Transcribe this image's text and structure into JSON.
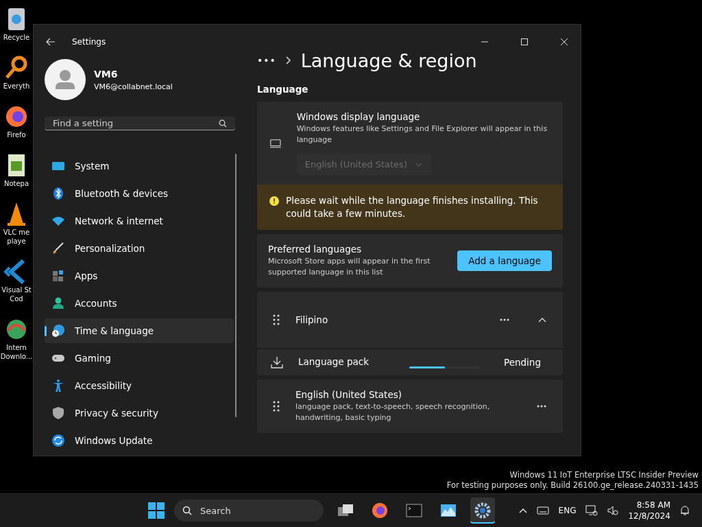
{
  "desktop_icons": [
    {
      "kind": "recycle",
      "label": "Recycle"
    },
    {
      "kind": "search",
      "label": "Everyth"
    },
    {
      "kind": "firefox",
      "label": "Firefo"
    },
    {
      "kind": "notepad",
      "label": "Notepa"
    },
    {
      "kind": "cone",
      "label": "VLC me\nplaye"
    },
    {
      "kind": "code",
      "label": "Visual St\nCod"
    },
    {
      "kind": "download",
      "label": "Intern\nDownlo..."
    }
  ],
  "window": {
    "title": "Settings"
  },
  "user": {
    "name": "VM6",
    "email": "VM6@collabnet.local"
  },
  "search": {
    "placeholder": "Find a setting"
  },
  "sidebar": {
    "items": [
      {
        "kind": "system",
        "label": "System",
        "selected": false
      },
      {
        "kind": "bluetooth",
        "label": "Bluetooth & devices",
        "selected": false
      },
      {
        "kind": "network",
        "label": "Network & internet",
        "selected": false
      },
      {
        "kind": "brush",
        "label": "Personalization",
        "selected": false
      },
      {
        "kind": "apps",
        "label": "Apps",
        "selected": false
      },
      {
        "kind": "accounts",
        "label": "Accounts",
        "selected": false
      },
      {
        "kind": "time",
        "label": "Time & language",
        "selected": true
      },
      {
        "kind": "gaming",
        "label": "Gaming",
        "selected": false
      },
      {
        "kind": "accessibility",
        "label": "Accessibility",
        "selected": false
      },
      {
        "kind": "shield",
        "label": "Privacy & security",
        "selected": false
      },
      {
        "kind": "update",
        "label": "Windows Update",
        "selected": false
      }
    ]
  },
  "breadcrumb": {
    "more": "•••",
    "title": "Language & region"
  },
  "section_title": "Language",
  "display_language": {
    "title": "Windows display language",
    "description": "Windows features like Settings and File Explorer will appear in this language",
    "value": "English (United States)",
    "disabled": true
  },
  "warning": "Please wait while the language finishes installing. This could take a few minutes.",
  "preferred": {
    "title": "Preferred languages",
    "description": "Microsoft Store apps will appear in the first supported language in this list",
    "button": "Add a language"
  },
  "languages": [
    {
      "name": "Filipino",
      "expanded": true,
      "children": [
        {
          "label": "Language pack",
          "status": "Pending",
          "level": 0.5
        }
      ]
    },
    {
      "name": "English (United States)",
      "description": "language pack, text-to-speech, speech recognition, handwriting, basic typing"
    }
  ],
  "watermark": [
    "Windows 11 IoT Enterprise LTSC Insider Preview",
    "For testing purposes only. Build 26100.ge_release.240331-1435"
  ],
  "taskbar": {
    "search_placeholder": "Search",
    "apps": [
      {
        "kind": "taskview",
        "selected": false
      },
      {
        "kind": "firefox",
        "selected": false
      },
      {
        "kind": "terminal",
        "selected": false
      },
      {
        "kind": "monitor",
        "selected": false
      },
      {
        "kind": "settings",
        "selected": true
      }
    ],
    "language": "ENG",
    "time": "8:58 AM",
    "date": "12/8/2024"
  }
}
